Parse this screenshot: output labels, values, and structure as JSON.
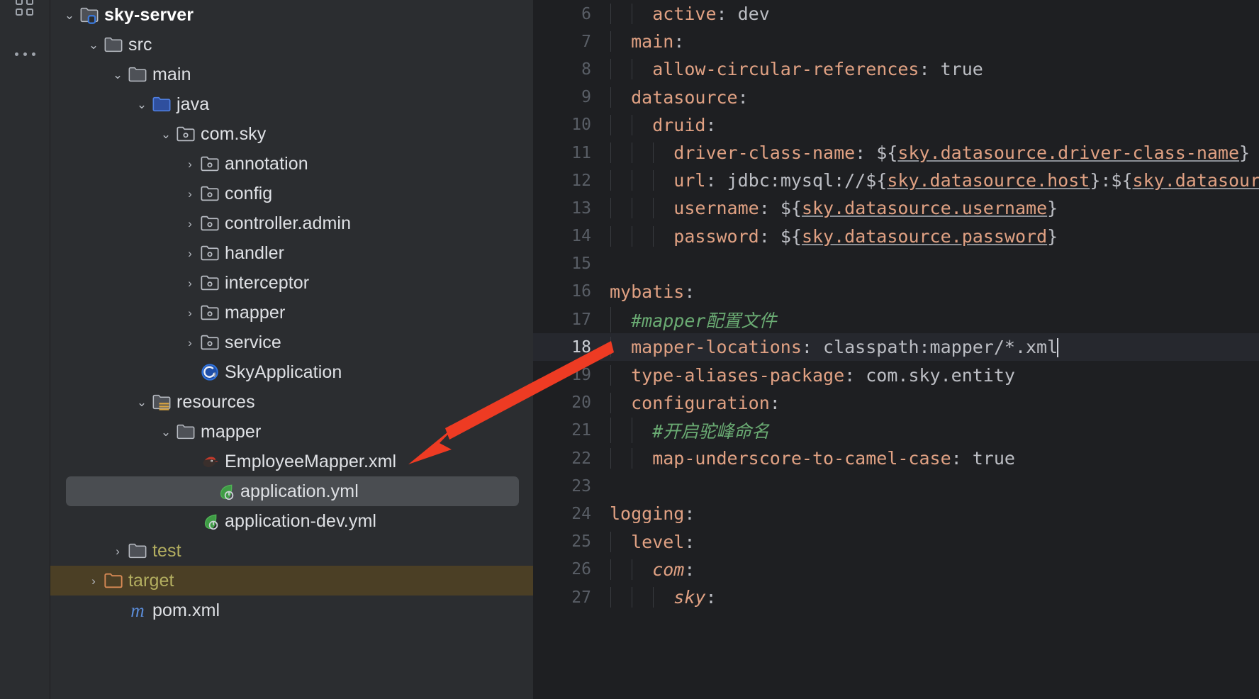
{
  "activity_bar": {
    "icons": [
      {
        "name": "apps-grid-icon",
        "label": "Apps"
      },
      {
        "name": "more-options-icon",
        "label": "More"
      }
    ]
  },
  "project_tree": {
    "items": [
      {
        "label": "sky-server",
        "indent": 0,
        "chevron": "down",
        "icon": "module-folder-icon",
        "bold": true,
        "selected": "none"
      },
      {
        "label": "src",
        "indent": 1,
        "chevron": "down",
        "icon": "folder-icon",
        "bold": false,
        "selected": "none"
      },
      {
        "label": "main",
        "indent": 2,
        "chevron": "down",
        "icon": "folder-icon",
        "bold": false,
        "selected": "none"
      },
      {
        "label": "java",
        "indent": 3,
        "chevron": "down",
        "icon": "source-root-icon",
        "bold": false,
        "selected": "none"
      },
      {
        "label": "com.sky",
        "indent": 4,
        "chevron": "down",
        "icon": "package-icon",
        "bold": false,
        "selected": "none"
      },
      {
        "label": "annotation",
        "indent": 5,
        "chevron": "right",
        "icon": "package-icon",
        "bold": false,
        "selected": "none"
      },
      {
        "label": "config",
        "indent": 5,
        "chevron": "right",
        "icon": "package-icon",
        "bold": false,
        "selected": "none"
      },
      {
        "label": "controller.admin",
        "indent": 5,
        "chevron": "right",
        "icon": "package-icon",
        "bold": false,
        "selected": "none"
      },
      {
        "label": "handler",
        "indent": 5,
        "chevron": "right",
        "icon": "package-icon",
        "bold": false,
        "selected": "none"
      },
      {
        "label": "interceptor",
        "indent": 5,
        "chevron": "right",
        "icon": "package-icon",
        "bold": false,
        "selected": "none"
      },
      {
        "label": "mapper",
        "indent": 5,
        "chevron": "right",
        "icon": "package-icon",
        "bold": false,
        "selected": "none"
      },
      {
        "label": "service",
        "indent": 5,
        "chevron": "right",
        "icon": "package-icon",
        "bold": false,
        "selected": "none"
      },
      {
        "label": "SkyApplication",
        "indent": 5,
        "chevron": "none",
        "icon": "spring-class-icon",
        "bold": false,
        "selected": "none"
      },
      {
        "label": "resources",
        "indent": 3,
        "chevron": "down",
        "icon": "resource-root-icon",
        "bold": false,
        "selected": "none"
      },
      {
        "label": "mapper",
        "indent": 4,
        "chevron": "down",
        "icon": "folder-icon",
        "bold": false,
        "selected": "none"
      },
      {
        "label": "EmployeeMapper.xml",
        "indent": 5,
        "chevron": "none",
        "icon": "mybatis-xml-icon",
        "bold": false,
        "selected": "none"
      },
      {
        "label": "application.yml",
        "indent": 5,
        "chevron": "none",
        "icon": "spring-yaml-icon",
        "bold": false,
        "selected": "row"
      },
      {
        "label": "application-dev.yml",
        "indent": 5,
        "chevron": "none",
        "icon": "spring-yaml-icon",
        "bold": false,
        "selected": "none"
      },
      {
        "label": "test",
        "indent": 2,
        "chevron": "right",
        "icon": "folder-icon",
        "bold": false,
        "selected": "none",
        "color": "olive"
      },
      {
        "label": "target",
        "indent": 1,
        "chevron": "right",
        "icon": "excluded-folder-icon",
        "bold": false,
        "selected": "full",
        "color": "olive"
      },
      {
        "label": "pom.xml",
        "indent": 2,
        "chevron": "none",
        "icon": "maven-icon",
        "bold": false,
        "selected": "none"
      }
    ]
  },
  "editor": {
    "current_line": 18,
    "lines": [
      {
        "num": 6,
        "indent": 4,
        "tokens": [
          {
            "t": "active",
            "c": "k"
          },
          {
            "t": ": ",
            "c": "v"
          },
          {
            "t": "dev",
            "c": "v"
          }
        ]
      },
      {
        "num": 7,
        "indent": 2,
        "tokens": [
          {
            "t": "main",
            "c": "k"
          },
          {
            "t": ":",
            "c": "v"
          }
        ]
      },
      {
        "num": 8,
        "indent": 4,
        "tokens": [
          {
            "t": "allow-circular-references",
            "c": "k"
          },
          {
            "t": ": ",
            "c": "v"
          },
          {
            "t": "true",
            "c": "v"
          }
        ]
      },
      {
        "num": 9,
        "indent": 2,
        "tokens": [
          {
            "t": "datasource",
            "c": "k"
          },
          {
            "t": ":",
            "c": "v"
          }
        ]
      },
      {
        "num": 10,
        "indent": 4,
        "tokens": [
          {
            "t": "druid",
            "c": "k"
          },
          {
            "t": ":",
            "c": "v"
          }
        ]
      },
      {
        "num": 11,
        "indent": 6,
        "tokens": [
          {
            "t": "driver-class-name",
            "c": "k"
          },
          {
            "t": ": ",
            "c": "v"
          },
          {
            "t": "${",
            "c": "v"
          },
          {
            "t": "sky.datasource.driver-class-name",
            "c": "ph"
          },
          {
            "t": "}",
            "c": "v"
          }
        ]
      },
      {
        "num": 12,
        "indent": 6,
        "tokens": [
          {
            "t": "url",
            "c": "k"
          },
          {
            "t": ": ",
            "c": "v"
          },
          {
            "t": "jdbc:mysql://${",
            "c": "v"
          },
          {
            "t": "sky.datasource.host",
            "c": "ph"
          },
          {
            "t": "}:${",
            "c": "v"
          },
          {
            "t": "sky.datasource.port",
            "c": "ph"
          },
          {
            "t": "}",
            "c": "v"
          }
        ]
      },
      {
        "num": 13,
        "indent": 6,
        "tokens": [
          {
            "t": "username",
            "c": "k"
          },
          {
            "t": ": ",
            "c": "v"
          },
          {
            "t": "${",
            "c": "v"
          },
          {
            "t": "sky.datasource.username",
            "c": "ph"
          },
          {
            "t": "}",
            "c": "v"
          }
        ]
      },
      {
        "num": 14,
        "indent": 6,
        "tokens": [
          {
            "t": "password",
            "c": "k"
          },
          {
            "t": ": ",
            "c": "v"
          },
          {
            "t": "${",
            "c": "v"
          },
          {
            "t": "sky.datasource.password",
            "c": "ph"
          },
          {
            "t": "}",
            "c": "v"
          }
        ]
      },
      {
        "num": 15,
        "indent": 0,
        "tokens": []
      },
      {
        "num": 16,
        "indent": 0,
        "tokens": [
          {
            "t": "mybatis",
            "c": "k"
          },
          {
            "t": ":",
            "c": "v"
          }
        ]
      },
      {
        "num": 17,
        "indent": 2,
        "tokens": [
          {
            "t": "#mapper配置文件",
            "c": "cm"
          }
        ]
      },
      {
        "num": 18,
        "indent": 2,
        "tokens": [
          {
            "t": "mapper-locations",
            "c": "k"
          },
          {
            "t": ": ",
            "c": "v"
          },
          {
            "t": "classpath:mapper/*.xml",
            "c": "v"
          },
          {
            "t": "",
            "c": "caret"
          }
        ]
      },
      {
        "num": 19,
        "indent": 2,
        "tokens": [
          {
            "t": "type-aliases-package",
            "c": "k"
          },
          {
            "t": ": ",
            "c": "v"
          },
          {
            "t": "com.sky.entity",
            "c": "v"
          }
        ]
      },
      {
        "num": 20,
        "indent": 2,
        "tokens": [
          {
            "t": "configuration",
            "c": "k"
          },
          {
            "t": ":",
            "c": "v"
          }
        ]
      },
      {
        "num": 21,
        "indent": 4,
        "tokens": [
          {
            "t": "#开启驼峰命名",
            "c": "cm"
          }
        ]
      },
      {
        "num": 22,
        "indent": 4,
        "tokens": [
          {
            "t": "map-underscore-to-camel-case",
            "c": "k"
          },
          {
            "t": ": ",
            "c": "v"
          },
          {
            "t": "true",
            "c": "v"
          }
        ]
      },
      {
        "num": 23,
        "indent": 0,
        "tokens": []
      },
      {
        "num": 24,
        "indent": 0,
        "tokens": [
          {
            "t": "logging",
            "c": "k"
          },
          {
            "t": ":",
            "c": "v"
          }
        ]
      },
      {
        "num": 25,
        "indent": 2,
        "tokens": [
          {
            "t": "level",
            "c": "k"
          },
          {
            "t": ":",
            "c": "v"
          }
        ]
      },
      {
        "num": 26,
        "indent": 4,
        "tokens": [
          {
            "t": "com",
            "c": "k ital"
          },
          {
            "t": ":",
            "c": "v"
          }
        ]
      },
      {
        "num": 27,
        "indent": 6,
        "tokens": [
          {
            "t": "sky",
            "c": "k ital"
          },
          {
            "t": ":",
            "c": "v"
          }
        ]
      }
    ]
  },
  "annotation": {
    "arrow": {
      "name": "red-pointer-arrow",
      "color": "#ee3b23",
      "from": "code line 18",
      "to": "EmployeeMapper.xml"
    }
  },
  "colors": {
    "panel_bg": "#2b2d30",
    "editor_bg": "#1e1f22",
    "selection_bg": "#4a4d51",
    "excluded_bg": "#4b3f25",
    "key": "#e0a183",
    "value": "#bcbec4",
    "comment": "#6aab73",
    "arrow": "#ee3b23"
  }
}
